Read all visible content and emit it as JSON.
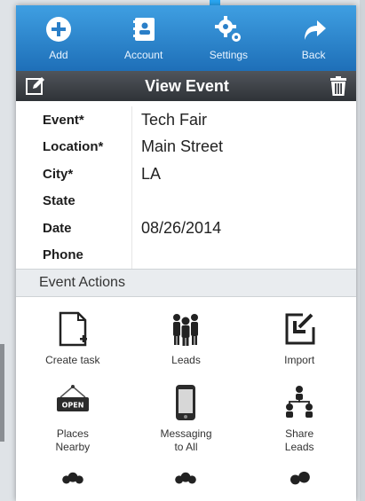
{
  "colors": {
    "nav_top": "#3f9fe2",
    "nav_bottom": "#1e6fb8",
    "titlebar": "#3a3e43",
    "accent": "#2aa7f3"
  },
  "nav": {
    "items": [
      {
        "label": "Add",
        "icon": "plus-circle-icon"
      },
      {
        "label": "Account",
        "icon": "address-book-icon"
      },
      {
        "label": "Settings",
        "icon": "gear-icon"
      },
      {
        "label": "Back",
        "icon": "back-arrow-icon"
      }
    ]
  },
  "titlebar": {
    "title": "View Event",
    "left_icon": "edit-icon",
    "right_icon": "trash-icon"
  },
  "details": {
    "rows": [
      {
        "label": "Event*",
        "value": "Tech Fair"
      },
      {
        "label": "Location*",
        "value": "Main Street"
      },
      {
        "label": "City*",
        "value": "LA"
      },
      {
        "label": "State",
        "value": ""
      },
      {
        "label": "Date",
        "value": "08/26/2014"
      },
      {
        "label": "Phone",
        "value": ""
      }
    ]
  },
  "actions": {
    "header": "Event Actions",
    "items": [
      {
        "label": "Create task",
        "icon": "new-document-icon"
      },
      {
        "label": "Leads",
        "icon": "people-icon"
      },
      {
        "label": "Import",
        "icon": "import-icon"
      },
      {
        "label": "Places\nNearby",
        "icon": "open-sign-icon"
      },
      {
        "label": "Messaging\nto All",
        "icon": "phone-icon"
      },
      {
        "label": "Share\nLeads",
        "icon": "share-network-icon"
      }
    ]
  }
}
